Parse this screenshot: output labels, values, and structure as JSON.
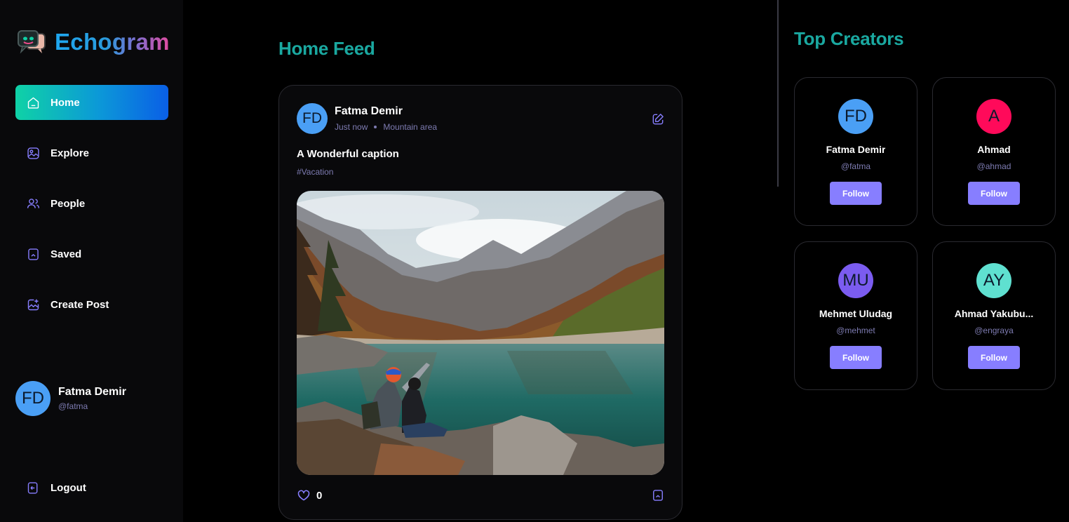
{
  "brand": {
    "name": "Echogram"
  },
  "sidebar": {
    "items": [
      {
        "label": "Home",
        "icon": "home-icon",
        "active": true
      },
      {
        "label": "Explore",
        "icon": "gallery-icon",
        "active": false
      },
      {
        "label": "People",
        "icon": "people-icon",
        "active": false
      },
      {
        "label": "Saved",
        "icon": "bookmark-icon",
        "active": false
      },
      {
        "label": "Create Post",
        "icon": "add-image-icon",
        "active": false
      }
    ],
    "profile": {
      "initials": "FD",
      "name": "Fatma Demir",
      "handle": "@fatma",
      "color": "#4a9ff5"
    },
    "logout": {
      "label": "Logout",
      "icon": "logout-icon"
    }
  },
  "main": {
    "title": "Home Feed",
    "post": {
      "author_initials": "FD",
      "author": "Fatma Demir",
      "time": "Just now",
      "location": "Mountain area",
      "caption": "A Wonderful caption",
      "tag": "#Vacation",
      "likes": "0",
      "avatar_color": "#4a9ff5"
    }
  },
  "right": {
    "title": "Top Creators",
    "creators": [
      {
        "initials": "FD",
        "name": "Fatma Demir",
        "handle": "@fatma",
        "color": "#4a9ff5",
        "button": "Follow"
      },
      {
        "initials": "A",
        "name": "Ahmad",
        "handle": "@ahmad",
        "color": "#ff0a5a",
        "button": "Follow"
      },
      {
        "initials": "MU",
        "name": "Mehmet Uludag",
        "handle": "@mehmet",
        "color": "#7b5cf0",
        "button": "Follow"
      },
      {
        "initials": "AY",
        "name": "Ahmad Yakubu...",
        "handle": "@engraya",
        "color": "#5fe0d0",
        "button": "Follow"
      }
    ]
  },
  "colors": {
    "accent": "#877eff",
    "title": "#1aa8a0",
    "muted": "#7d7bb1",
    "active_gradient": [
      "#0fd2a6",
      "#0a5fe6"
    ]
  }
}
